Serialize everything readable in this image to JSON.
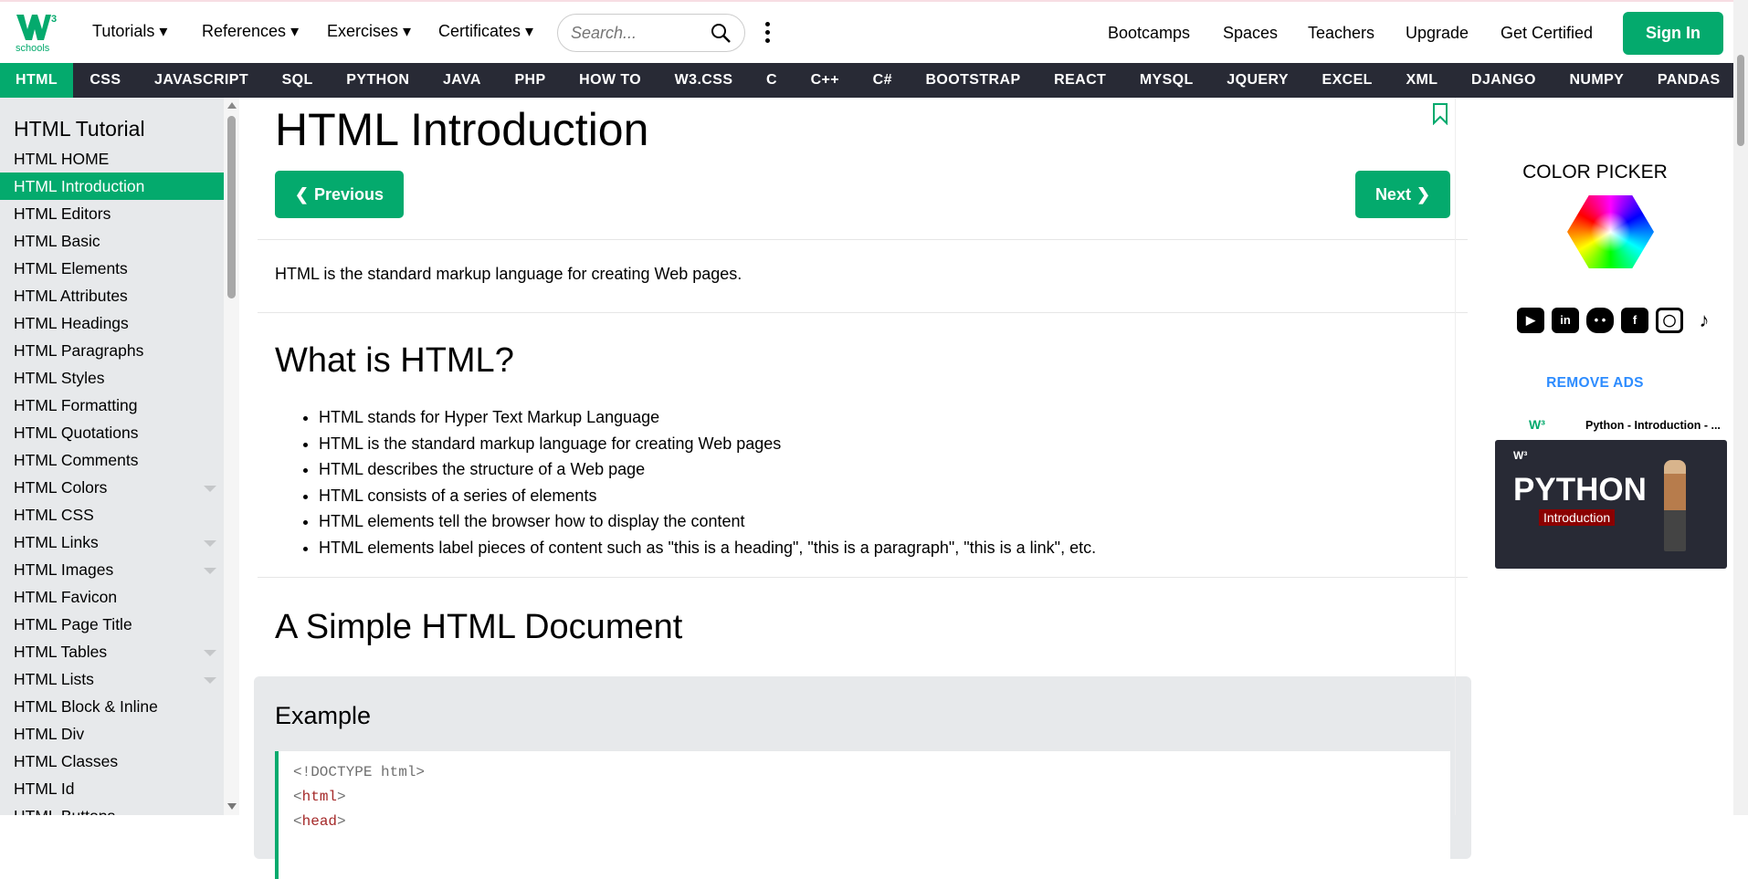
{
  "header": {
    "logo_text": "w3schools",
    "menus": [
      "Tutorials",
      "References",
      "Exercises",
      "Certificates"
    ],
    "search_placeholder": "Search...",
    "right_links": [
      "Bootcamps",
      "Spaces",
      "Teachers",
      "Upgrade",
      "Get Certified"
    ],
    "sign_in": "Sign In"
  },
  "nav": {
    "items": [
      "HTML",
      "CSS",
      "JAVASCRIPT",
      "SQL",
      "PYTHON",
      "JAVA",
      "PHP",
      "HOW TO",
      "W3.CSS",
      "C",
      "C++",
      "C#",
      "BOOTSTRAP",
      "REACT",
      "MYSQL",
      "JQUERY",
      "EXCEL",
      "XML",
      "DJANGO",
      "NUMPY",
      "PANDAS"
    ],
    "active": "HTML",
    "more": "❯"
  },
  "sidebar": {
    "title": "HTML Tutorial",
    "items": [
      {
        "label": "HTML HOME"
      },
      {
        "label": "HTML Introduction",
        "active": true
      },
      {
        "label": "HTML Editors"
      },
      {
        "label": "HTML Basic"
      },
      {
        "label": "HTML Elements"
      },
      {
        "label": "HTML Attributes"
      },
      {
        "label": "HTML Headings"
      },
      {
        "label": "HTML Paragraphs"
      },
      {
        "label": "HTML Styles"
      },
      {
        "label": "HTML Formatting"
      },
      {
        "label": "HTML Quotations"
      },
      {
        "label": "HTML Comments"
      },
      {
        "label": "HTML Colors",
        "caret": true
      },
      {
        "label": "HTML CSS"
      },
      {
        "label": "HTML Links",
        "caret": true
      },
      {
        "label": "HTML Images",
        "caret": true
      },
      {
        "label": "HTML Favicon"
      },
      {
        "label": "HTML Page Title"
      },
      {
        "label": "HTML Tables",
        "caret": true
      },
      {
        "label": "HTML Lists",
        "caret": true
      },
      {
        "label": "HTML Block & Inline"
      },
      {
        "label": "HTML Div"
      },
      {
        "label": "HTML Classes"
      },
      {
        "label": "HTML Id"
      },
      {
        "label": "HTML Buttons"
      }
    ]
  },
  "main": {
    "title": "HTML Introduction",
    "prev": "Previous",
    "next": "Next",
    "intro": "HTML is the standard markup language for creating Web pages.",
    "section1": "What is HTML?",
    "bullets": [
      "HTML stands for Hyper Text Markup Language",
      "HTML is the standard markup language for creating Web pages",
      "HTML describes the structure of a Web page",
      "HTML consists of a series of elements",
      "HTML elements tell the browser how to display the content",
      "HTML elements label pieces of content such as \"this is a heading\", \"this is a paragraph\", \"this is a link\", etc."
    ],
    "section2": "A Simple HTML Document",
    "example_title": "Example",
    "code": [
      "<!DOCTYPE html>",
      "html",
      "head"
    ]
  },
  "right": {
    "color_picker": "COLOR PICKER",
    "remove_ads": "REMOVE ADS",
    "video_title": "Python - Introduction - ...",
    "video_heading": "PYTHON",
    "video_sub": "Introduction"
  },
  "colors": {
    "brand": "#04aa6d",
    "nav_bg": "#282a35",
    "sidebar_bg": "#e7e9eb",
    "link_blue": "#2d8cff"
  }
}
